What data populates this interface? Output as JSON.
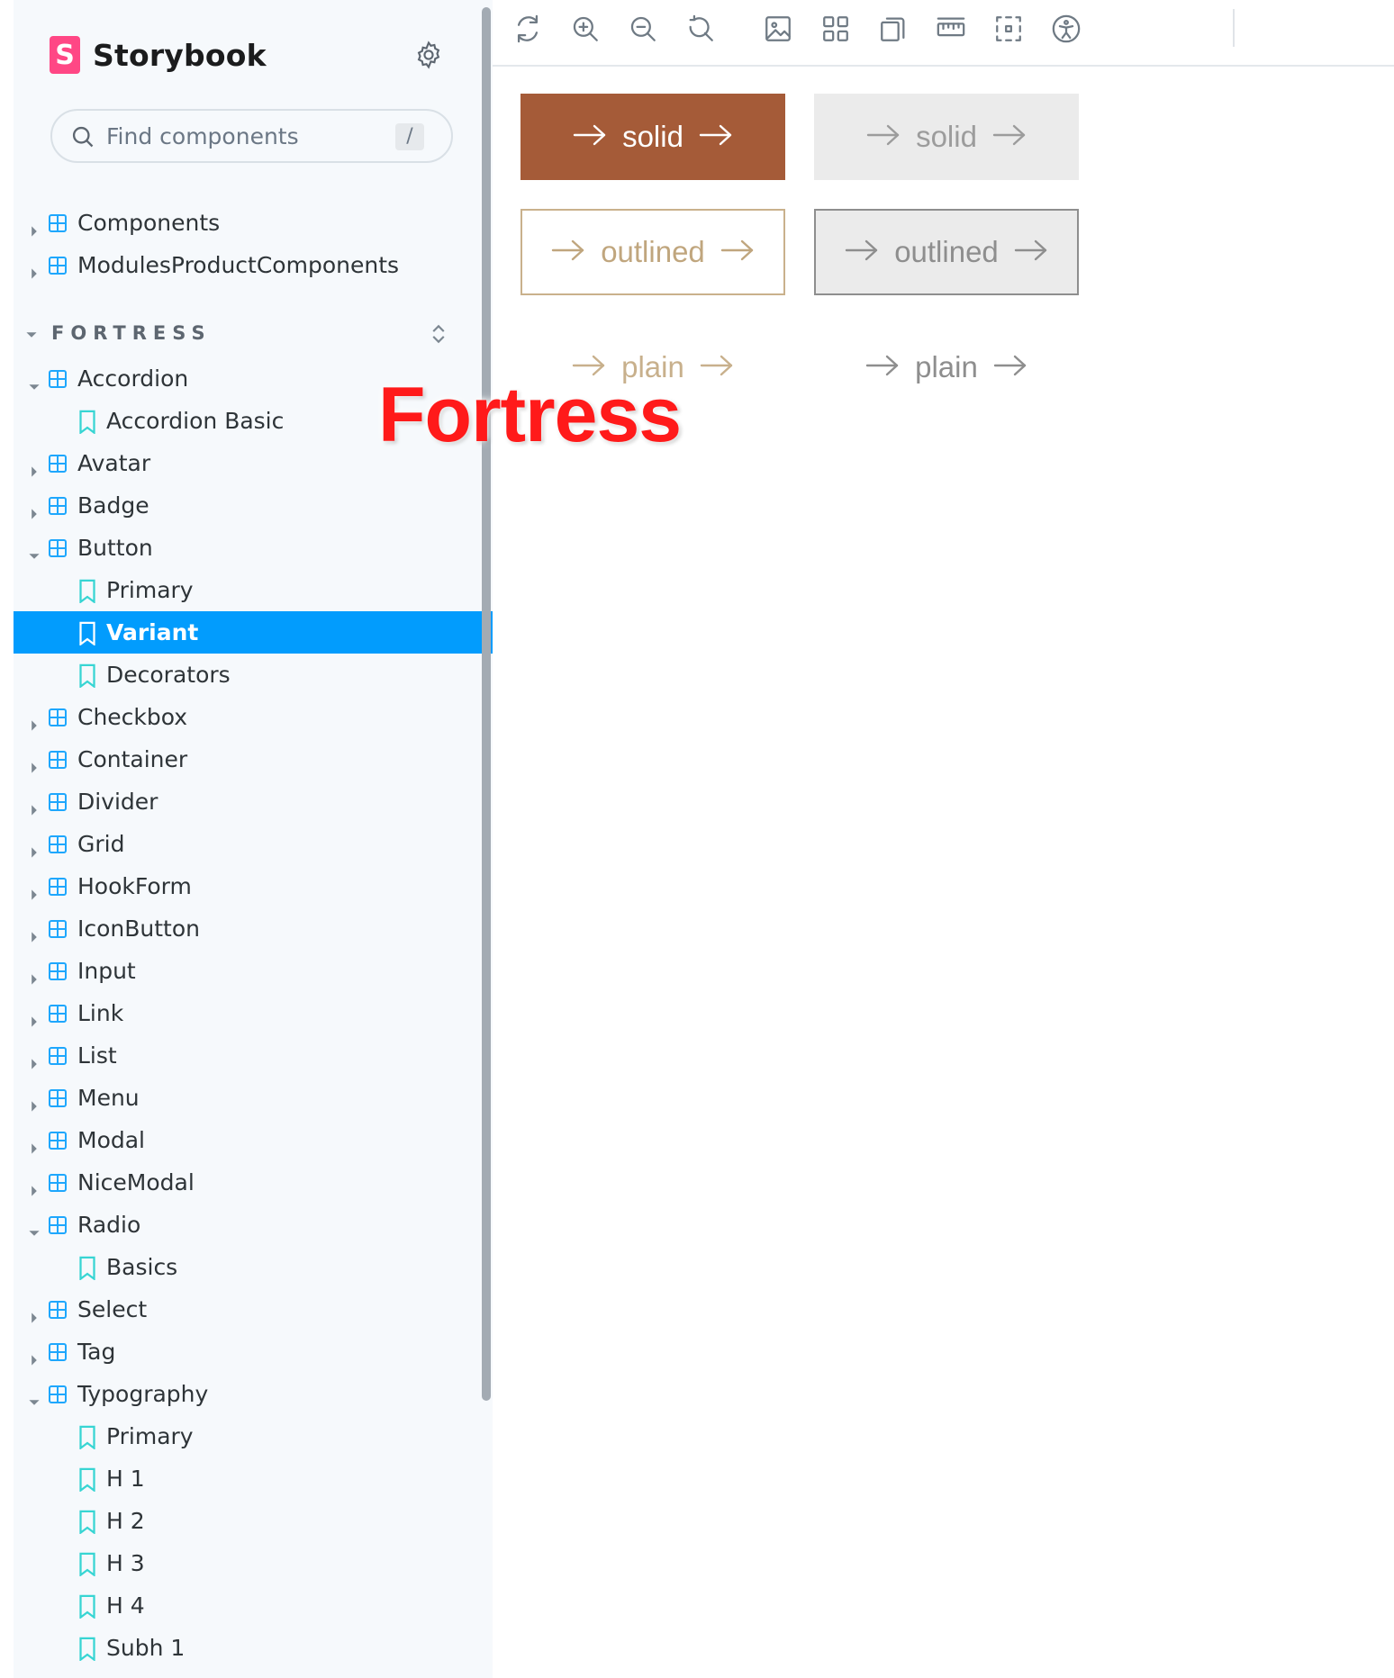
{
  "brand": {
    "name": "Storybook",
    "logo_letter": "S"
  },
  "search": {
    "placeholder": "Find components",
    "shortcut": "/"
  },
  "tree_top": [
    {
      "label": "Components"
    },
    {
      "label": "ModulesProductComponents"
    }
  ],
  "section": {
    "label": "FORTRESS"
  },
  "tree": [
    {
      "label": "Accordion",
      "type": "component",
      "expanded": true
    },
    {
      "label": "Accordion Basic",
      "type": "story"
    },
    {
      "label": "Avatar",
      "type": "component"
    },
    {
      "label": "Badge",
      "type": "component"
    },
    {
      "label": "Button",
      "type": "component",
      "expanded": true
    },
    {
      "label": "Primary",
      "type": "story"
    },
    {
      "label": "Variant",
      "type": "story",
      "selected": true
    },
    {
      "label": "Decorators",
      "type": "story"
    },
    {
      "label": "Checkbox",
      "type": "component"
    },
    {
      "label": "Container",
      "type": "component"
    },
    {
      "label": "Divider",
      "type": "component"
    },
    {
      "label": "Grid",
      "type": "component"
    },
    {
      "label": "HookForm",
      "type": "component"
    },
    {
      "label": "IconButton",
      "type": "component"
    },
    {
      "label": "Input",
      "type": "component"
    },
    {
      "label": "Link",
      "type": "component"
    },
    {
      "label": "List",
      "type": "component"
    },
    {
      "label": "Menu",
      "type": "component"
    },
    {
      "label": "Modal",
      "type": "component"
    },
    {
      "label": "NiceModal",
      "type": "component"
    },
    {
      "label": "Radio",
      "type": "component",
      "expanded": true
    },
    {
      "label": "Basics",
      "type": "story"
    },
    {
      "label": "Select",
      "type": "component"
    },
    {
      "label": "Tag",
      "type": "component"
    },
    {
      "label": "Typography",
      "type": "component",
      "expanded": true
    },
    {
      "label": "Primary",
      "type": "story"
    },
    {
      "label": "H 1",
      "type": "story"
    },
    {
      "label": "H 2",
      "type": "story"
    },
    {
      "label": "H 3",
      "type": "story"
    },
    {
      "label": "H 4",
      "type": "story"
    },
    {
      "label": "Subh 1",
      "type": "story"
    }
  ],
  "toolbar_icons": [
    "reload-icon",
    "zoom-in-icon",
    "zoom-out-icon",
    "reset-zoom-icon",
    "background-icon",
    "grid-icon",
    "viewport-icon",
    "measure-icon",
    "outline-icon",
    "accessibility-icon"
  ],
  "canvas": {
    "buttons": [
      {
        "label": "solid",
        "variant": "solid",
        "disabled": false
      },
      {
        "label": "solid",
        "variant": "solid",
        "disabled": true
      },
      {
        "label": "outlined",
        "variant": "outlined",
        "disabled": false
      },
      {
        "label": "outlined",
        "variant": "outlined",
        "disabled": true
      },
      {
        "label": "plain",
        "variant": "plain",
        "disabled": false
      },
      {
        "label": "plain",
        "variant": "plain",
        "disabled": true
      }
    ],
    "overlay_title": "Fortress"
  },
  "colors": {
    "accent": "#029cfd",
    "brand": "#ff4785",
    "solid_button": "#a55b38",
    "outline_button": "#c9b18c",
    "story_icon": "#37d5d3",
    "component_icon": "#1ea7fd",
    "overlay_text": "#ff1a1a"
  }
}
